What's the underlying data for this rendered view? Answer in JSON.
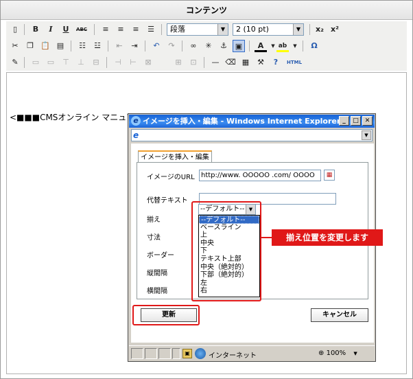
{
  "cms": {
    "title": "コンテンツ",
    "toolbar": {
      "format_select": "段落",
      "size_select": "2 (10 pt)",
      "strike_label": "ABC",
      "html_label": "HTML"
    },
    "editor_text": "<■■■CMSオンライン マニュア"
  },
  "dialog": {
    "title": "イメージを挿入・編集 - Windows Internet Explorer",
    "tab": "イメージを挿入・編集",
    "url_label": "イメージのURL",
    "url_value": "http://www. OOOOO .com/ OOOO",
    "alt_label": "代替テキスト",
    "align_label": "揃え",
    "size_label": "寸法",
    "border_label": "ボーダー",
    "vspace_label": "縦間隔",
    "hspace_label": "横間隔",
    "align_selected": "--デフォルト--",
    "align_options": [
      "--デフォルト--",
      "ベースライン",
      "上",
      "中央",
      "下",
      "テキスト上部",
      "中央（絶対的）",
      "下部（絶対的）",
      "左",
      "右"
    ],
    "update_button": "更新",
    "cancel_button": "キャンセル",
    "status_zone": "インターネット",
    "zoom": "100%"
  },
  "callout": "揃え位置を変更します",
  "colors": {
    "annotation": "#e01818",
    "title_bar": "#1662d6",
    "selection": "#316ac5"
  }
}
